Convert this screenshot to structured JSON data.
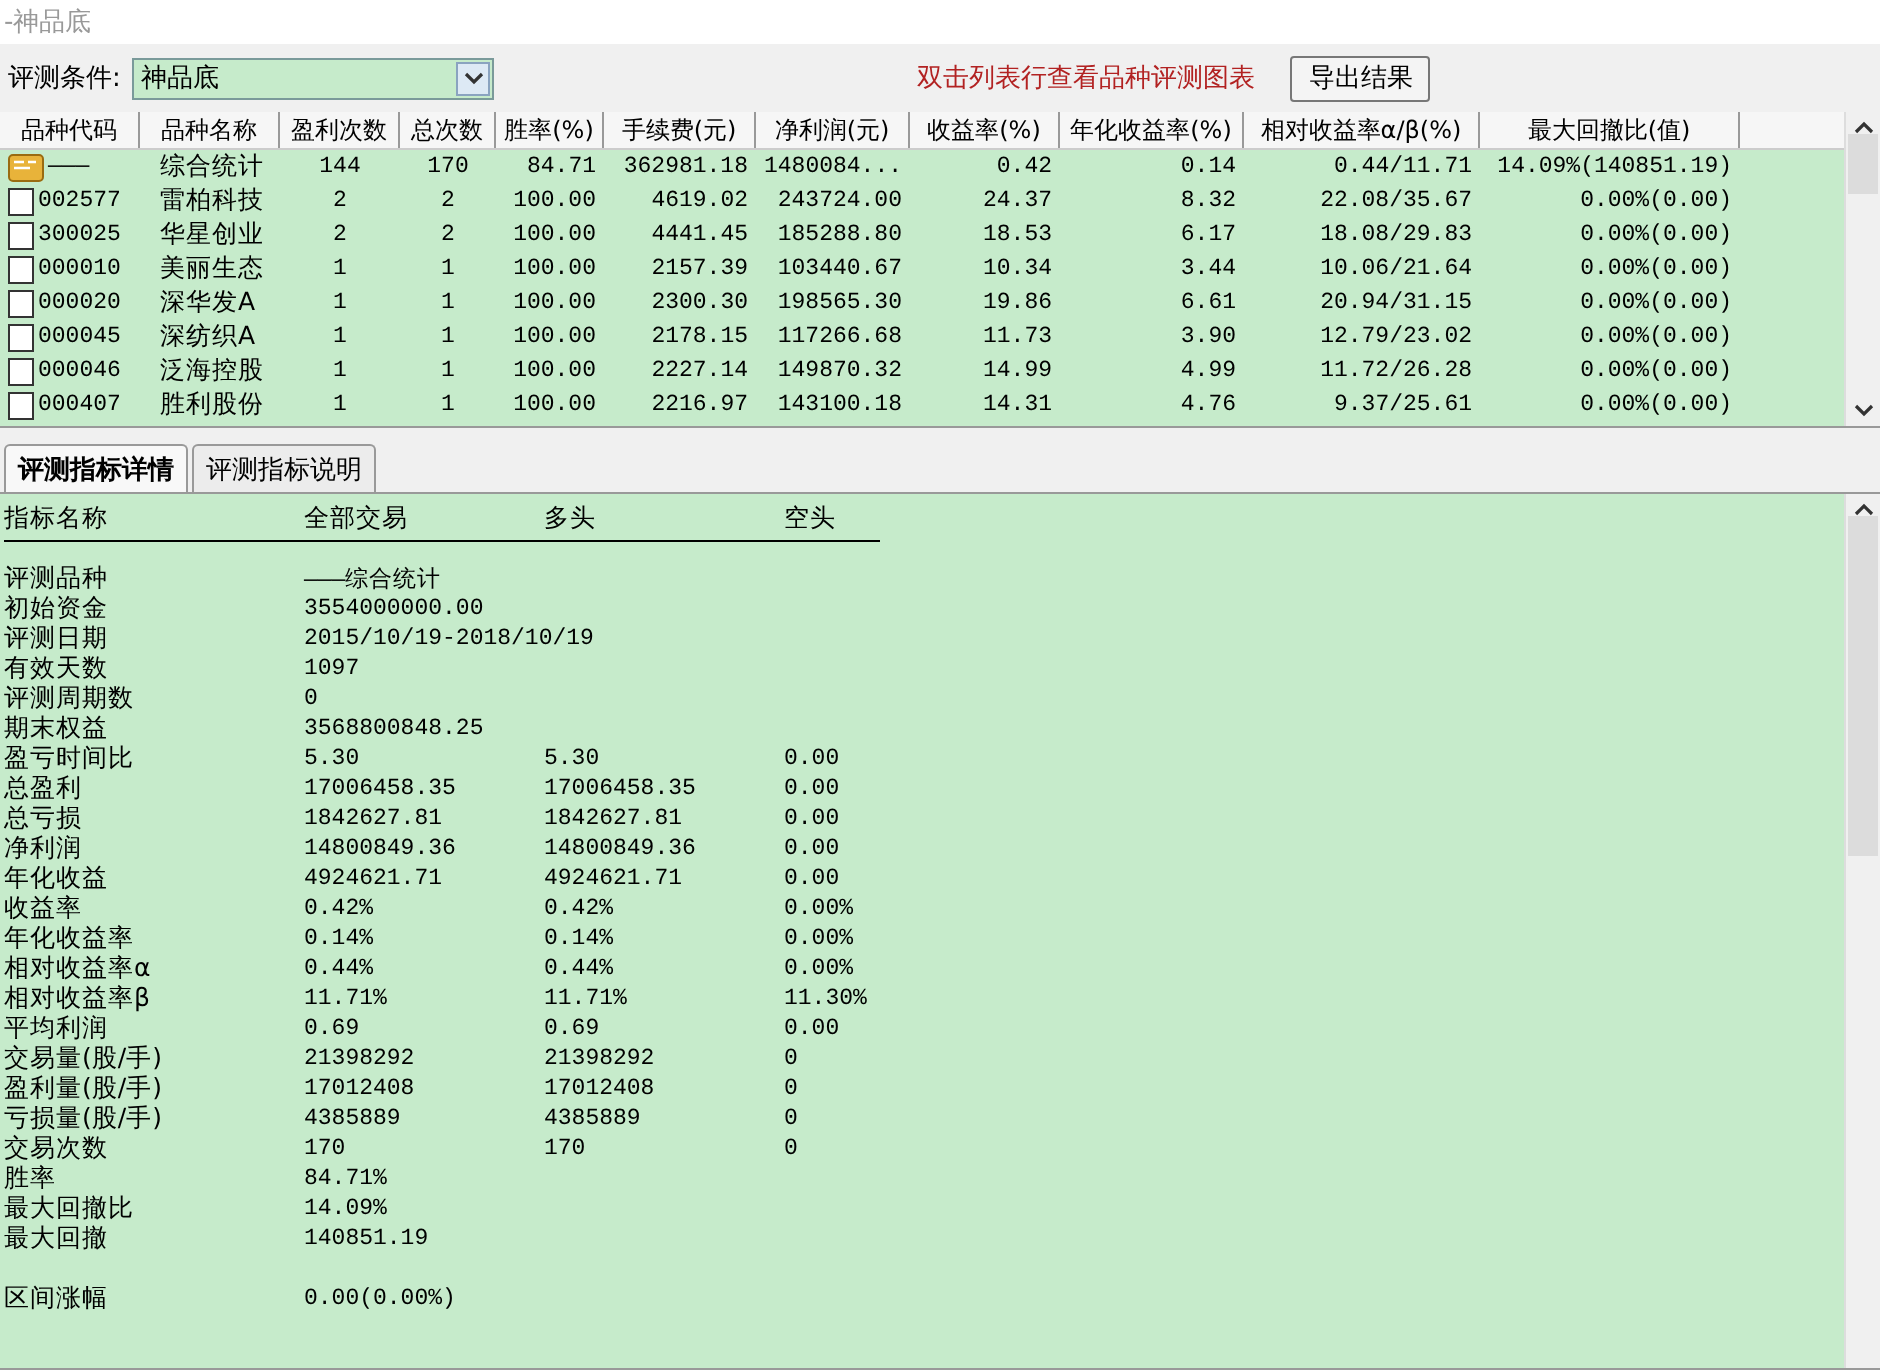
{
  "window": {
    "title": "-神品底"
  },
  "toolbar": {
    "condition_label": "评测条件:",
    "condition_value": "神品底",
    "hint": "双击列表行查看品种评测图表",
    "buttons": [
      "导出结果"
    ]
  },
  "table": {
    "columns": [
      "品种代码",
      "品种名称",
      "盈利次数",
      "总次数",
      "胜率(%)",
      "手续费(元)",
      "净利润(元)",
      "收益率(%)",
      "年化收益率(%)",
      "相对收益率α/β(%)",
      "最大回撤比(值)"
    ],
    "rows": [
      {
        "kind": "summary",
        "cells": [
          "———",
          "综合统计",
          "144",
          "170",
          "84.71",
          "362981.18",
          "1480084...",
          "0.42",
          "0.14",
          "0.44/11.71",
          "14.09%(140851.19)"
        ]
      },
      {
        "kind": "stock",
        "cells": [
          "002577",
          "雷柏科技",
          "2",
          "2",
          "100.00",
          "4619.02",
          "243724.00",
          "24.37",
          "8.32",
          "22.08/35.67",
          "0.00%(0.00)"
        ]
      },
      {
        "kind": "stock",
        "cells": [
          "300025",
          "华星创业",
          "2",
          "2",
          "100.00",
          "4441.45",
          "185288.80",
          "18.53",
          "6.17",
          "18.08/29.83",
          "0.00%(0.00)"
        ]
      },
      {
        "kind": "stock",
        "cells": [
          "000010",
          "美丽生态",
          "1",
          "1",
          "100.00",
          "2157.39",
          "103440.67",
          "10.34",
          "3.44",
          "10.06/21.64",
          "0.00%(0.00)"
        ]
      },
      {
        "kind": "stock",
        "cells": [
          "000020",
          "深华发A",
          "1",
          "1",
          "100.00",
          "2300.30",
          "198565.30",
          "19.86",
          "6.61",
          "20.94/31.15",
          "0.00%(0.00)"
        ]
      },
      {
        "kind": "stock",
        "cells": [
          "000045",
          "深纺织A",
          "1",
          "1",
          "100.00",
          "2178.15",
          "117266.68",
          "11.73",
          "3.90",
          "12.79/23.02",
          "0.00%(0.00)"
        ]
      },
      {
        "kind": "stock",
        "cells": [
          "000046",
          "泛海控股",
          "1",
          "1",
          "100.00",
          "2227.14",
          "149870.32",
          "14.99",
          "4.99",
          "11.72/26.28",
          "0.00%(0.00)"
        ]
      },
      {
        "kind": "stock",
        "cells": [
          "000407",
          "胜利股份",
          "1",
          "1",
          "100.00",
          "2216.97",
          "143100.18",
          "14.31",
          "4.76",
          "9.37/25.61",
          "0.00%(0.00)"
        ]
      }
    ]
  },
  "tabs": [
    {
      "label": "评测指标详情",
      "selected": true
    },
    {
      "label": "评测指标说明",
      "selected": false
    }
  ],
  "details": {
    "columns": [
      "指标名称",
      "全部交易",
      "多头",
      "空头"
    ],
    "rows": [
      {
        "kind": "line",
        "cells": [
          "评测品种",
          "———综合统计"
        ]
      },
      {
        "kind": "line",
        "cells": [
          "初始资金",
          "3554000000.00"
        ]
      },
      {
        "kind": "line",
        "cells": [
          "评测日期",
          "2015/10/19-2018/10/19"
        ]
      },
      {
        "kind": "line",
        "cells": [
          "有效天数",
          "1097"
        ]
      },
      {
        "kind": "line",
        "cells": [
          "评测周期数",
          "0"
        ]
      },
      {
        "kind": "line",
        "cells": [
          "期末权益",
          "3568800848.25"
        ]
      },
      {
        "kind": "line",
        "cells": [
          "盈亏时间比",
          "5.30",
          "5.30",
          "0.00"
        ]
      },
      {
        "kind": "line",
        "cells": [
          "总盈利",
          "17006458.35",
          "17006458.35",
          "0.00"
        ]
      },
      {
        "kind": "line",
        "cells": [
          "总亏损",
          "1842627.81",
          "1842627.81",
          "0.00"
        ]
      },
      {
        "kind": "line",
        "cells": [
          "净利润",
          "14800849.36",
          "14800849.36",
          "0.00"
        ]
      },
      {
        "kind": "line",
        "cells": [
          "年化收益",
          "4924621.71",
          "4924621.71",
          "0.00"
        ]
      },
      {
        "kind": "line",
        "cells": [
          "收益率",
          "0.42%",
          "0.42%",
          "0.00%"
        ]
      },
      {
        "kind": "line",
        "cells": [
          "年化收益率",
          "0.14%",
          "0.14%",
          "0.00%"
        ]
      },
      {
        "kind": "line",
        "cells": [
          "相对收益率α",
          "0.44%",
          "0.44%",
          "0.00%"
        ]
      },
      {
        "kind": "line",
        "cells": [
          "相对收益率β",
          "11.71%",
          "11.71%",
          "11.30%"
        ]
      },
      {
        "kind": "line",
        "cells": [
          "平均利润",
          "0.69",
          "0.69",
          "0.00"
        ]
      },
      {
        "kind": "line",
        "cells": [
          "交易量(股/手)",
          "21398292",
          "21398292",
          "0"
        ]
      },
      {
        "kind": "line",
        "cells": [
          "盈利量(股/手)",
          "17012408",
          "17012408",
          "0"
        ]
      },
      {
        "kind": "line",
        "cells": [
          "亏损量(股/手)",
          "4385889",
          "4385889",
          "0"
        ]
      },
      {
        "kind": "line",
        "cells": [
          "交易次数",
          "170",
          "170",
          "0"
        ]
      },
      {
        "kind": "line",
        "cells": [
          "胜率",
          "84.71%"
        ]
      },
      {
        "kind": "line",
        "cells": [
          "最大回撤比",
          "14.09%"
        ]
      },
      {
        "kind": "line",
        "cells": [
          "最大回撤",
          "140851.19"
        ]
      },
      {
        "kind": "gap",
        "cells": []
      },
      {
        "kind": "line",
        "cells": [
          "区间涨幅",
          "0.00(0.00%)"
        ]
      }
    ]
  }
}
